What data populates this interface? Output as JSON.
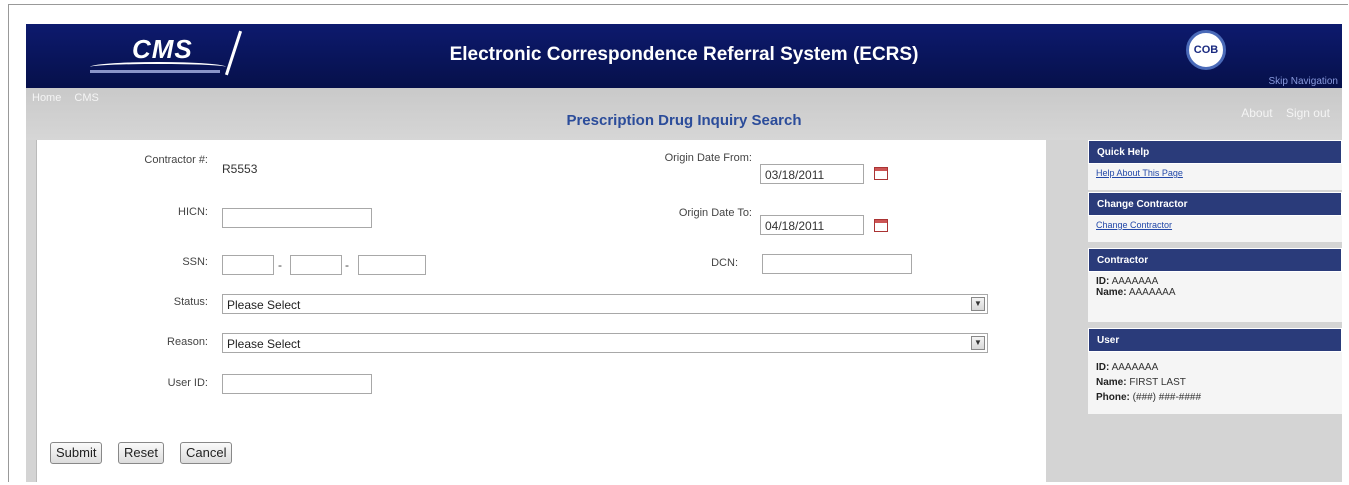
{
  "header": {
    "logo_text": "CMS",
    "title": "Electronic Correspondence Referral System (ECRS)",
    "cob_logo_text": "COB",
    "skip_nav": "Skip Navigation"
  },
  "nav": {
    "left": [
      "Home",
      "CMS"
    ],
    "right": [
      "About",
      "Sign out"
    ]
  },
  "page_title": "Prescription Drug Inquiry Search",
  "form": {
    "contractor_label": "Contractor #:",
    "contractor_value": "R5553",
    "hicn_label": "HICN:",
    "hicn_value": "",
    "ssn_label": "SSN:",
    "ssn_sep": "-",
    "status_label": "Status:",
    "status_value": "Please Select",
    "reason_label": "Reason:",
    "reason_value": "Please Select",
    "userid_label": "User ID:",
    "userid_value": "",
    "origin_from_label": "Origin Date From:",
    "origin_from_value": "03/18/2011",
    "origin_to_label": "Origin Date To:",
    "origin_to_value": "04/18/2011",
    "dcn_label": "DCN:",
    "dcn_value": ""
  },
  "buttons": {
    "submit": "Submit",
    "reset": "Reset",
    "cancel": "Cancel"
  },
  "sidebar": {
    "quick_help_title": "Quick Help",
    "quick_help_link": "Help About This Page",
    "change_contractor_title": "Change Contractor",
    "change_contractor_link": "Change Contractor",
    "contractor_title": "Contractor",
    "contractor_id_label": "ID:",
    "contractor_id": "AAAAAAA",
    "contractor_name_label": "Name:",
    "contractor_name": "AAAAAAA",
    "user_title": "User",
    "user_id_label": "ID:",
    "user_id": "AAAAAAA",
    "user_name_label": "Name:",
    "user_name": "FIRST LAST",
    "user_phone_label": "Phone:",
    "user_phone": "(###) ###-####"
  },
  "colors": {
    "banner": "#0d1a6e",
    "title_blue": "#2b4c9a",
    "sidebar_header": "#2a3b7a"
  }
}
